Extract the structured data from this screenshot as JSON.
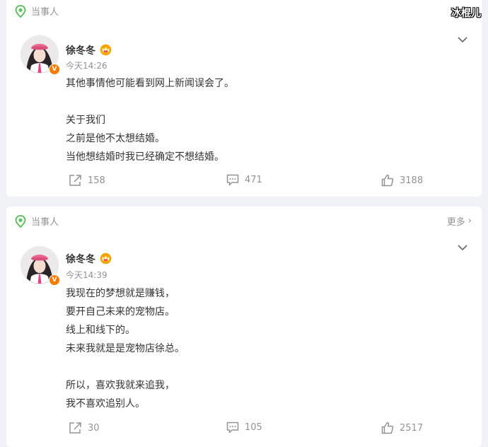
{
  "watermark": "冰棍儿",
  "posts": [
    {
      "topic": "当事人",
      "user_name": "徐冬冬",
      "time": "今天14:26",
      "verified_badge": "V",
      "lines": [
        "其他事情他可能看到网上新闻误会了。",
        "",
        "关于我们",
        "之前是他不太想结婚。",
        "当他想结婚时我已经确定不想结婚。"
      ],
      "shares": "158",
      "comments": "471",
      "likes": "3188"
    },
    {
      "topic": "当事人",
      "more_label": "更多",
      "user_name": "徐冬冬",
      "time": "今天14:39",
      "verified_badge": "V",
      "lines": [
        "我现在的梦想就是赚钱，",
        "要开自己未来的宠物店。",
        "线上和线下的。",
        "未来我就是是宠物店徐总。",
        "",
        "所以，喜欢我就来追我，",
        "我不喜欢追别人。"
      ],
      "shares": "30",
      "comments": "105",
      "likes": "2517"
    }
  ],
  "colors": {
    "background": "#f1f2f5",
    "card": "#ffffff",
    "text": "#333333",
    "muted": "#939393",
    "topic_green": "#5fc15f",
    "badge_orange": "#f57c00"
  },
  "icons": [
    "topic-location-icon",
    "chevron-down-icon",
    "crown-badge-icon",
    "share-icon",
    "comment-icon",
    "like-icon",
    "chevron-right-icon"
  ]
}
